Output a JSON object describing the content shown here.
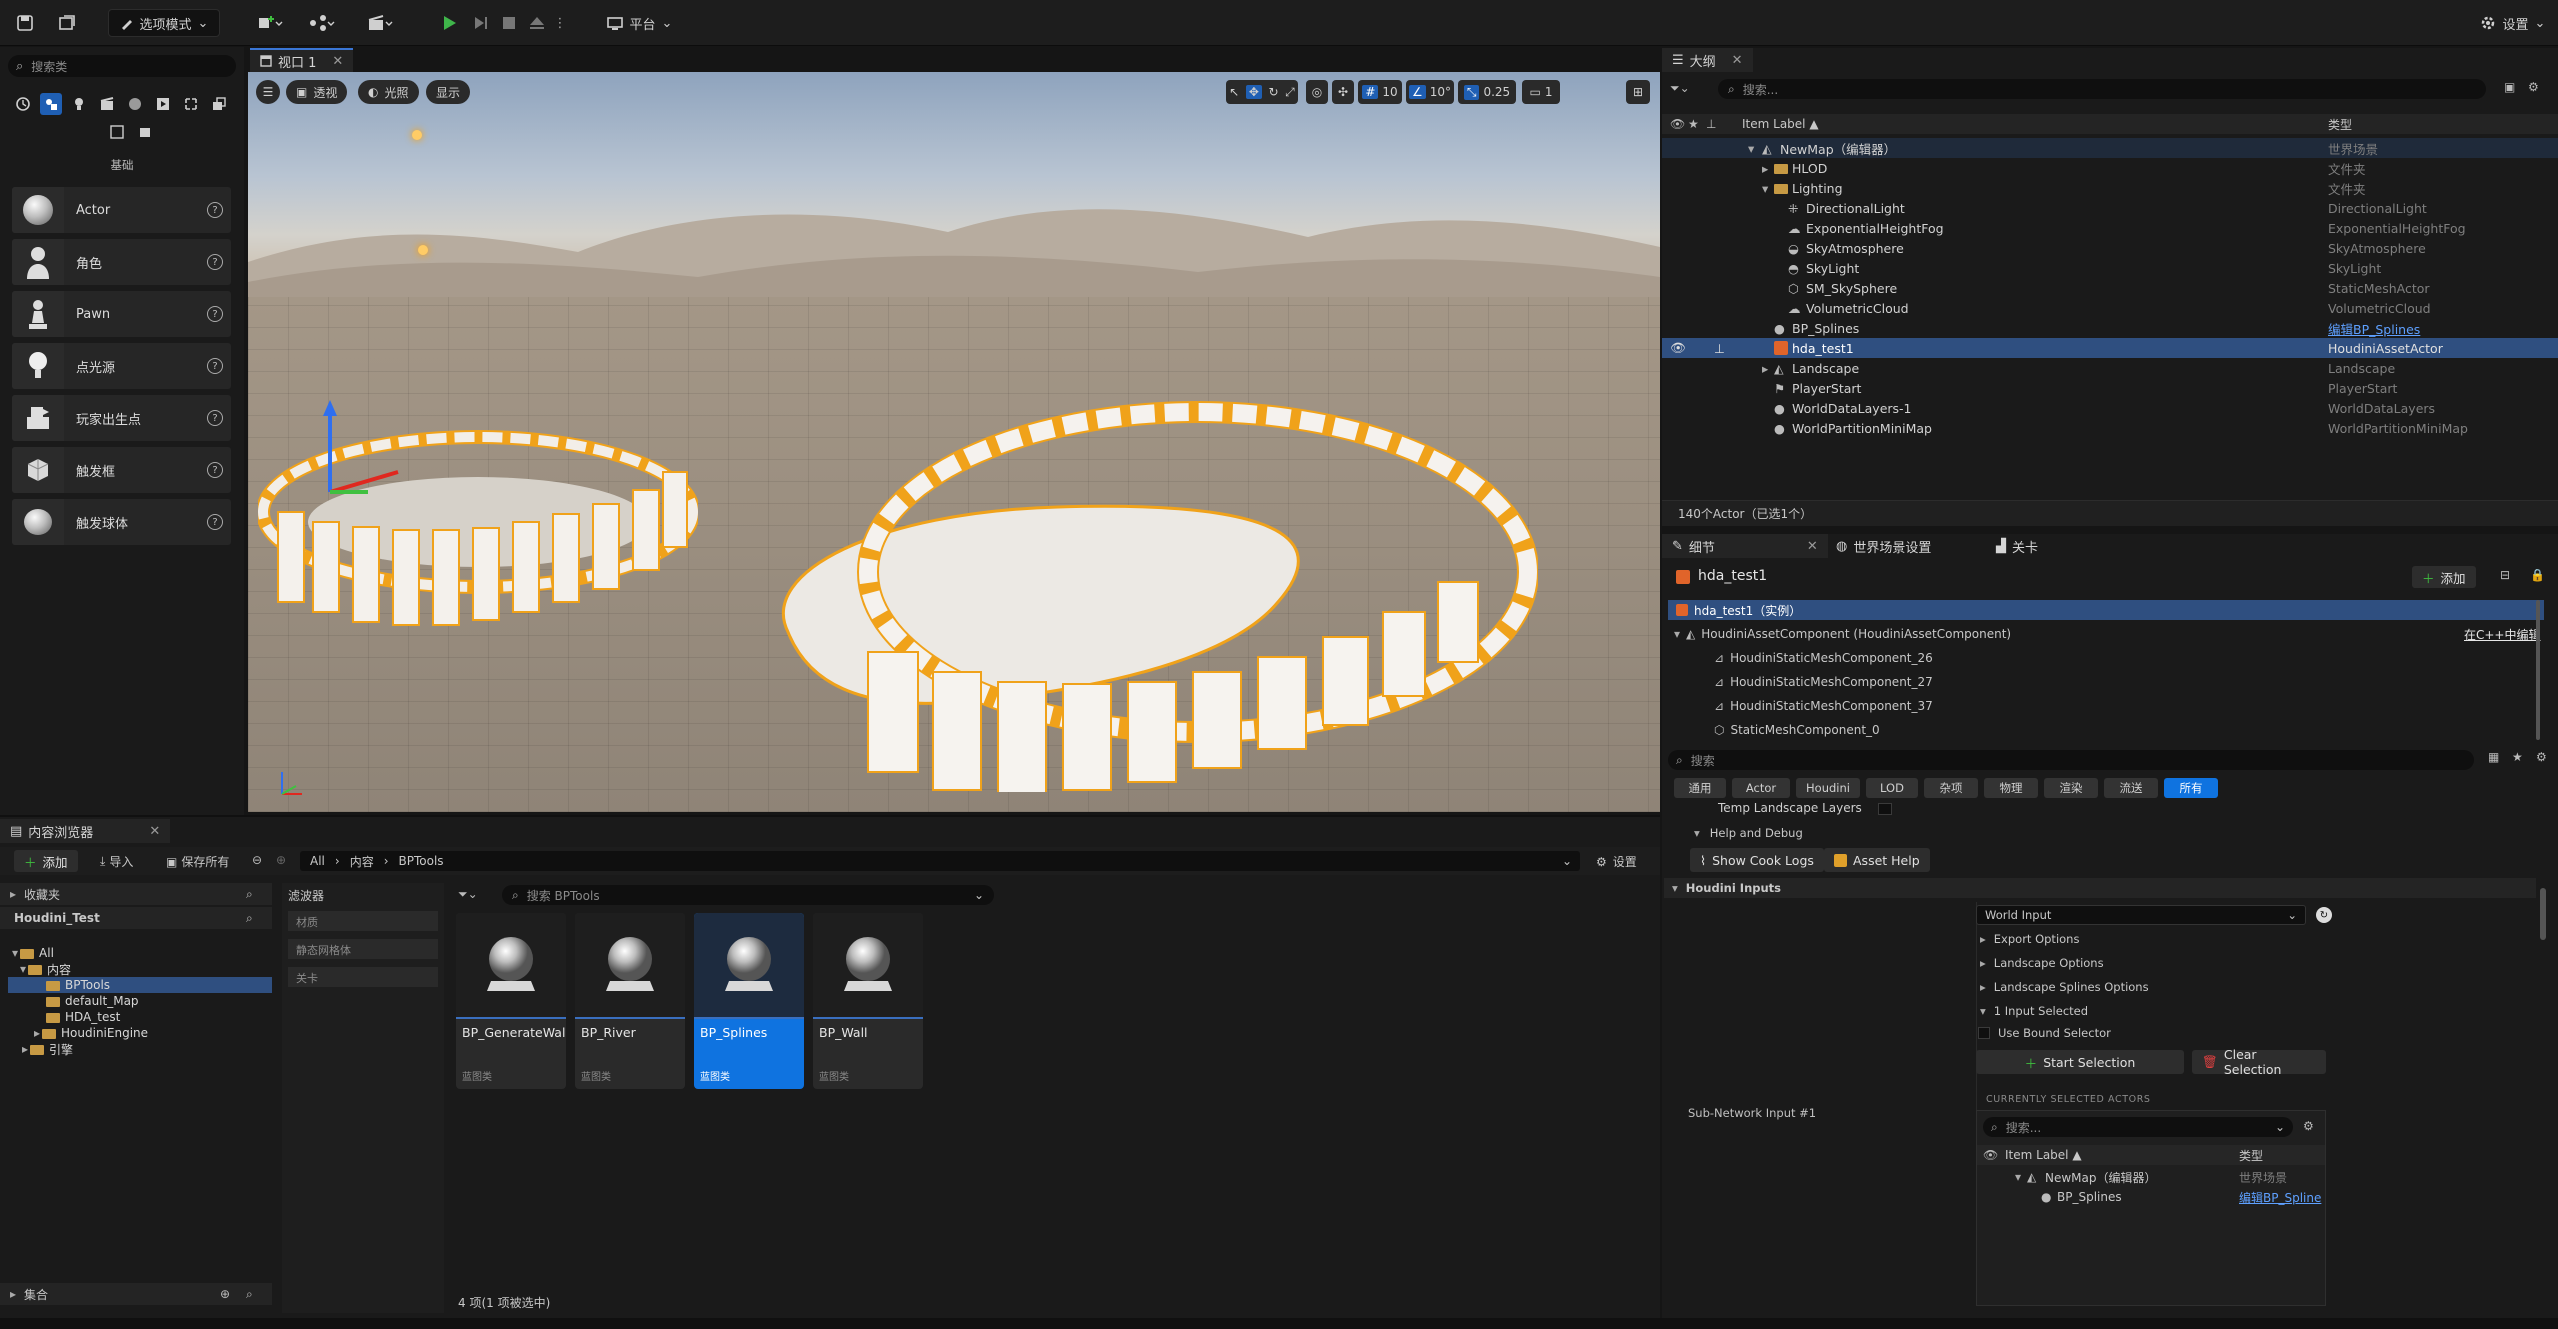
{
  "toolbar": {
    "mode_label": "选项模式",
    "platform_label": "平台",
    "settings_label": "设置"
  },
  "place_actors": {
    "search_placeholder": "搜索类",
    "section_label": "基础",
    "items": [
      {
        "label": "Actor",
        "icon": "actor-sphere-icon"
      },
      {
        "label": "角色",
        "icon": "character-icon"
      },
      {
        "label": "Pawn",
        "icon": "pawn-icon"
      },
      {
        "label": "点光源",
        "icon": "point-light-icon"
      },
      {
        "label": "玩家出生点",
        "icon": "player-start-icon"
      },
      {
        "label": "触发框",
        "icon": "trigger-box-icon"
      },
      {
        "label": "触发球体",
        "icon": "trigger-sphere-icon"
      }
    ]
  },
  "viewport": {
    "tab_label": "视口 1",
    "perspective_label": "透视",
    "lighting_label": "光照",
    "show_label": "显示",
    "grid_snap": "10",
    "rotation_snap": "10°",
    "scale_snap": "0.25",
    "camera_speed": "1"
  },
  "outliner": {
    "tab_label": "大纲",
    "search_placeholder": "搜索...",
    "col_label": "Item Label ▲",
    "col_type": "类型",
    "rows": [
      {
        "label": "NewMap（编辑器）",
        "type": "世界场景"
      },
      {
        "label": "HLOD",
        "type": "文件夹"
      },
      {
        "label": "Lighting",
        "type": "文件夹"
      },
      {
        "label": "DirectionalLight",
        "type": "DirectionalLight"
      },
      {
        "label": "ExponentialHeightFog",
        "type": "ExponentialHeightFog"
      },
      {
        "label": "SkyAtmosphere",
        "type": "SkyAtmosphere"
      },
      {
        "label": "SkyLight",
        "type": "SkyLight"
      },
      {
        "label": "SM_SkySphere",
        "type": "StaticMeshActor"
      },
      {
        "label": "VolumetricCloud",
        "type": "VolumetricCloud"
      },
      {
        "label": "BP_Splines",
        "type": "编辑BP_Splines"
      },
      {
        "label": "hda_test1",
        "type": "HoudiniAssetActor"
      },
      {
        "label": "Landscape",
        "type": "Landscape"
      },
      {
        "label": "PlayerStart",
        "type": "PlayerStart"
      },
      {
        "label": "WorldDataLayers-1",
        "type": "WorldDataLayers"
      },
      {
        "label": "WorldPartitionMiniMap",
        "type": "WorldPartitionMiniMap"
      }
    ],
    "status": "140个Actor（已选1个）"
  },
  "details": {
    "tab_label": "细节",
    "world_settings_tab": "世界场景设置",
    "level_tab": "关卡",
    "actor_name": "hda_test1",
    "add_label": "添加",
    "instance_label": "hda_test1（实例）",
    "components": [
      "HoudiniAssetComponent (HoudiniAssetComponent)",
      "HoudiniStaticMeshComponent_26",
      "HoudiniStaticMeshComponent_27",
      "HoudiniStaticMeshComponent_37",
      "StaticMeshComponent_0"
    ],
    "edit_in_cpp": "在C++中编辑",
    "search_placeholder": "搜索",
    "filters": [
      "通用",
      "Actor",
      "Houdini",
      "LOD",
      "杂项",
      "物理",
      "渲染",
      "流送",
      "所有"
    ],
    "temp_landscape_layers": "Temp Landscape Layers",
    "help_debug": "Help and Debug",
    "show_cook_logs": "Show Cook Logs",
    "asset_help": "Asset Help",
    "houdini_inputs": "Houdini Inputs",
    "sub_network_input": "Sub-Network Input #1",
    "input_type": "World Input",
    "export_options": "Export Options",
    "landscape_options": "Landscape Options",
    "landscape_splines_options": "Landscape Splines Options",
    "input_selected": "1 Input Selected",
    "use_bound_selector": "Use Bound Selector",
    "start_selection": "Start Selection",
    "clear_selection": "Clear Selection",
    "currently_selected": "CURRENTLY SELECTED ACTORS",
    "sel_search_placeholder": "搜索...",
    "sel_col_label": "Item Label ▲",
    "sel_col_type": "类型",
    "sel_rows": [
      {
        "label": "NewMap（编辑器）",
        "type": "世界场景"
      },
      {
        "label": "BP_Splines",
        "type": "编辑BP_Spline"
      }
    ]
  },
  "content_browser": {
    "tab_label": "内容浏览器",
    "add_label": "添加",
    "import_label": "导入",
    "save_all_label": "保存所有",
    "path": [
      "All",
      "内容",
      "BPTools"
    ],
    "settings_label": "设置",
    "favorites_label": "收藏夹",
    "project_label": "Houdini_Test",
    "tree": [
      {
        "label": "All",
        "depth": 0
      },
      {
        "label": "内容",
        "depth": 1
      },
      {
        "label": "BPTools",
        "depth": 2
      },
      {
        "label": "default_Map",
        "depth": 2
      },
      {
        "label": "HDA_test",
        "depth": 2
      },
      {
        "label": "HoudiniEngine",
        "depth": 2
      },
      {
        "label": "引擎",
        "depth": 1
      }
    ],
    "collections_label": "集合",
    "filters_label": "滤波器",
    "filter_items": [
      "材质",
      "静态网格体",
      "关卡"
    ],
    "search_placeholder": "搜索 BPTools",
    "assets": [
      {
        "name": "BP_GenerateWalls",
        "kind": "蓝图类"
      },
      {
        "name": "BP_River",
        "kind": "蓝图类"
      },
      {
        "name": "BP_Splines",
        "kind": "蓝图类"
      },
      {
        "name": "BP_Wall",
        "kind": "蓝图类"
      }
    ],
    "status": "4 项(1 项被选中)"
  }
}
